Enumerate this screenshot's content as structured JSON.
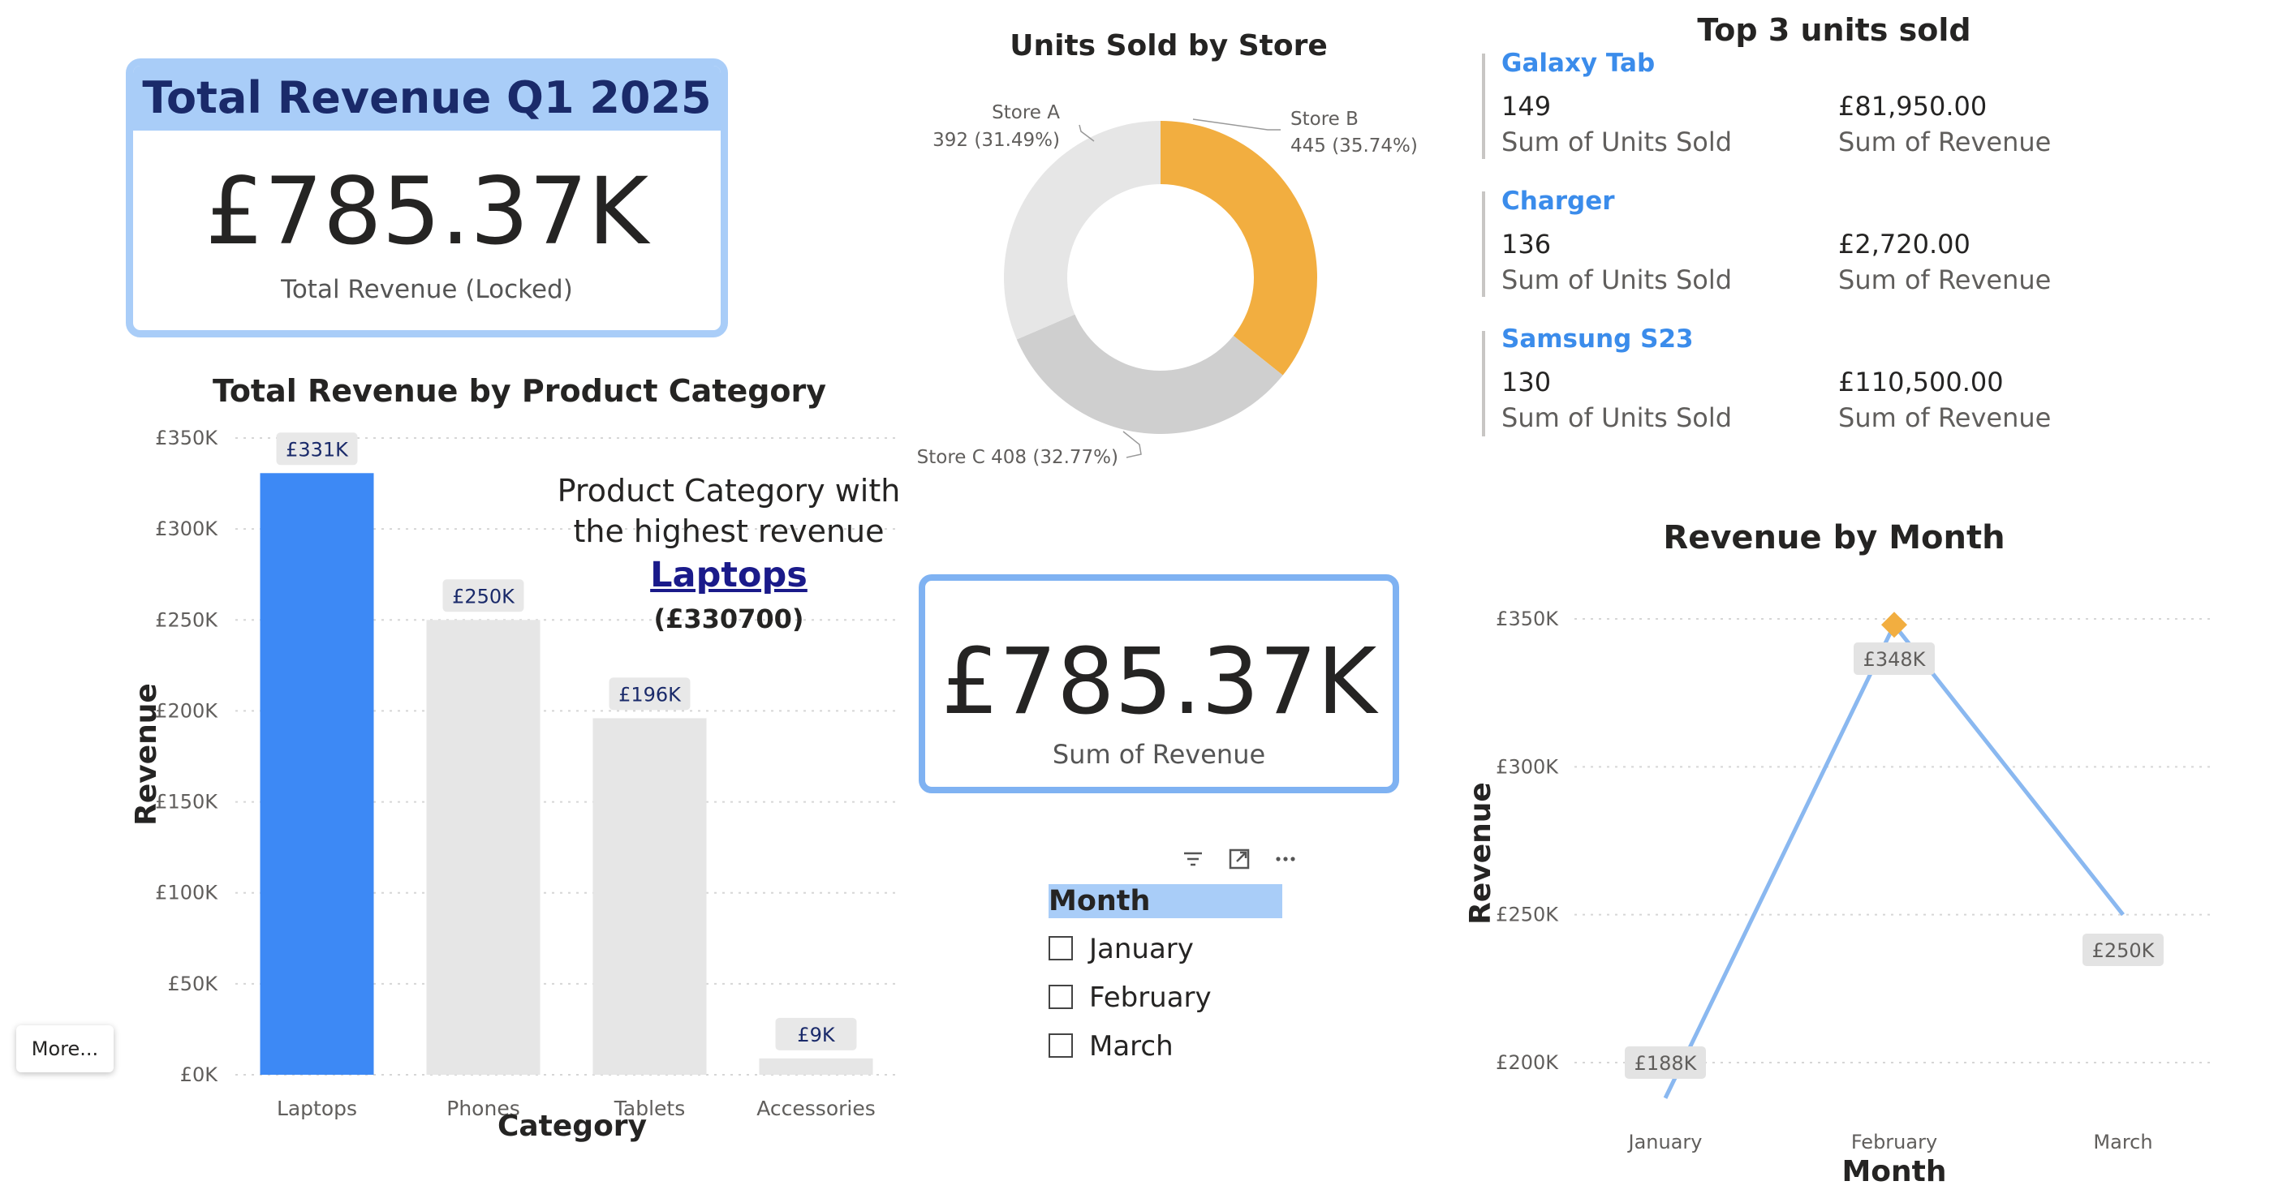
{
  "kpi_total_revenue_q1": {
    "title": "Total Revenue Q1 2025",
    "value": "£785.37K",
    "label": "Total Revenue  (Locked)"
  },
  "kpi_sum_revenue": {
    "value": "£785.37K",
    "label": "Sum of Revenue"
  },
  "product_callout": {
    "line1": "Product Category with",
    "line2": "the highest revenue",
    "product": "Laptops",
    "amount": "(£330700)"
  },
  "top3": {
    "title": "Top 3 units sold",
    "items": [
      {
        "name": "Galaxy Tab",
        "units": "149",
        "units_label": "Sum of Units Sold",
        "revenue": "£81,950.00",
        "revenue_label": "Sum of Revenue"
      },
      {
        "name": "Charger",
        "units": "136",
        "units_label": "Sum of Units Sold",
        "revenue": "£2,720.00",
        "revenue_label": "Sum of Revenue"
      },
      {
        "name": "Samsung S23",
        "units": "130",
        "units_label": "Sum of Units Sold",
        "revenue": "£110,500.00",
        "revenue_label": "Sum of Revenue"
      }
    ]
  },
  "slicer": {
    "header": "Month",
    "options": [
      "January",
      "February",
      "March"
    ],
    "tool_icons": [
      "filter-icon",
      "focus-mode-icon",
      "more-options-icon"
    ]
  },
  "more_button": "More...",
  "colors": {
    "accent_blue": "#3d89f5",
    "light_gray": "#e6e6e6",
    "mid_gray": "#cfcfcf",
    "orange": "#f2ae40",
    "line_blue": "#8ab8f0",
    "card_border": "#a9cdf8"
  },
  "chart_data": [
    {
      "type": "bar",
      "title": "Total Revenue by Product Category",
      "xlabel": "Category",
      "ylabel": "Revenue",
      "categories": [
        "Laptops",
        "Phones",
        "Tablets",
        "Accessories"
      ],
      "values": [
        330700,
        250000,
        196000,
        9000
      ],
      "data_labels": [
        "£331K",
        "£250K",
        "£196K",
        "£9K"
      ],
      "highlight_index": 0,
      "ylim": [
        0,
        350000
      ],
      "yticks": [
        0,
        50000,
        100000,
        150000,
        200000,
        250000,
        300000,
        350000
      ],
      "ytick_labels": [
        "£0K",
        "£50K",
        "£100K",
        "£150K",
        "£200K",
        "£250K",
        "£300K",
        "£350K"
      ],
      "grid": true
    },
    {
      "type": "pie",
      "donut": true,
      "title": "Units Sold by Store",
      "slices": [
        {
          "name": "Store B",
          "value": 445,
          "label": "445 (35.74%)",
          "color": "#f2ae40"
        },
        {
          "name": "Store C",
          "value": 408,
          "label": "408 (32.77%)",
          "color": "#cfcfcf"
        },
        {
          "name": "Store A",
          "value": 392,
          "label": "392 (31.49%)",
          "color": "#e6e6e6"
        }
      ]
    },
    {
      "type": "line",
      "title": "Revenue by Month",
      "xlabel": "Month",
      "ylabel": "Revenue",
      "categories": [
        "January",
        "February",
        "March"
      ],
      "values": [
        188000,
        348000,
        250000
      ],
      "data_labels": [
        "£188K",
        "£348K",
        "£250K"
      ],
      "highlight_index": 1,
      "ylim": [
        180000,
        360000
      ],
      "yticks": [
        200000,
        250000,
        300000,
        350000
      ],
      "ytick_labels": [
        "£200K",
        "£250K",
        "£300K",
        "£350K"
      ],
      "grid": true
    }
  ]
}
